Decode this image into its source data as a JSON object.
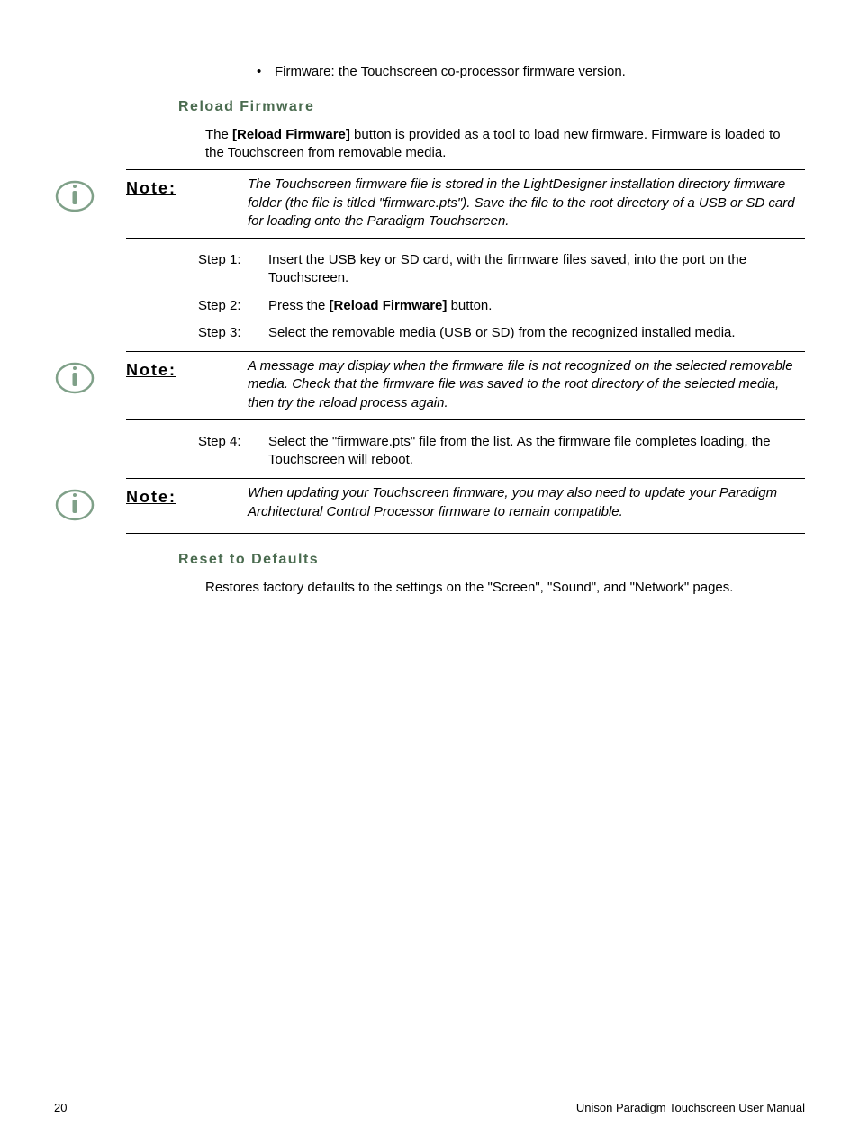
{
  "bullet1": "Firmware: the Touchscreen co-processor firmware version.",
  "headings": {
    "reload": "Reload Firmware",
    "reset": "Reset to Defaults"
  },
  "intro": {
    "pre": "The ",
    "bold": "[Reload Firmware]",
    "post": " button is provided as a tool to load new firmware. Firmware is loaded to the Touchscreen from removable media."
  },
  "noteLabel": "Note:",
  "notes": {
    "n1": "The Touchscreen firmware file is stored in the LightDesigner installation directory firmware folder (the file is titled \"firmware.pts\"). Save the file to the root directory of a USB or SD card for loading onto the Paradigm Touchscreen.",
    "n2": "A message may display when the firmware file is not recognized on the selected removable media. Check that the firmware file was saved to the root directory of the selected media, then try the reload process again.",
    "n3": "When updating your Touchscreen firmware, you may also need to update your Paradigm Architectural Control Processor firmware to remain compatible."
  },
  "steps": {
    "s1": {
      "label": "Step 1:",
      "text": "Insert the USB key or SD card, with the firmware files saved, into the port on the Touchscreen."
    },
    "s2": {
      "label": "Step 2:",
      "pre": "Press the ",
      "bold": "[Reload Firmware]",
      "post": " button."
    },
    "s3": {
      "label": "Step 3:",
      "text": "Select the removable media (USB or SD) from the recognized installed media."
    },
    "s4": {
      "label": "Step 4:",
      "text": "Select the \"firmware.pts\" file from the list. As the firmware file completes loading, the Touchscreen will reboot."
    }
  },
  "resetText": "Restores factory defaults to the settings on the \"Screen\", \"Sound\", and \"Network\" pages.",
  "footer": {
    "page": "20",
    "title": "Unison Paradigm Touchscreen User Manual"
  }
}
